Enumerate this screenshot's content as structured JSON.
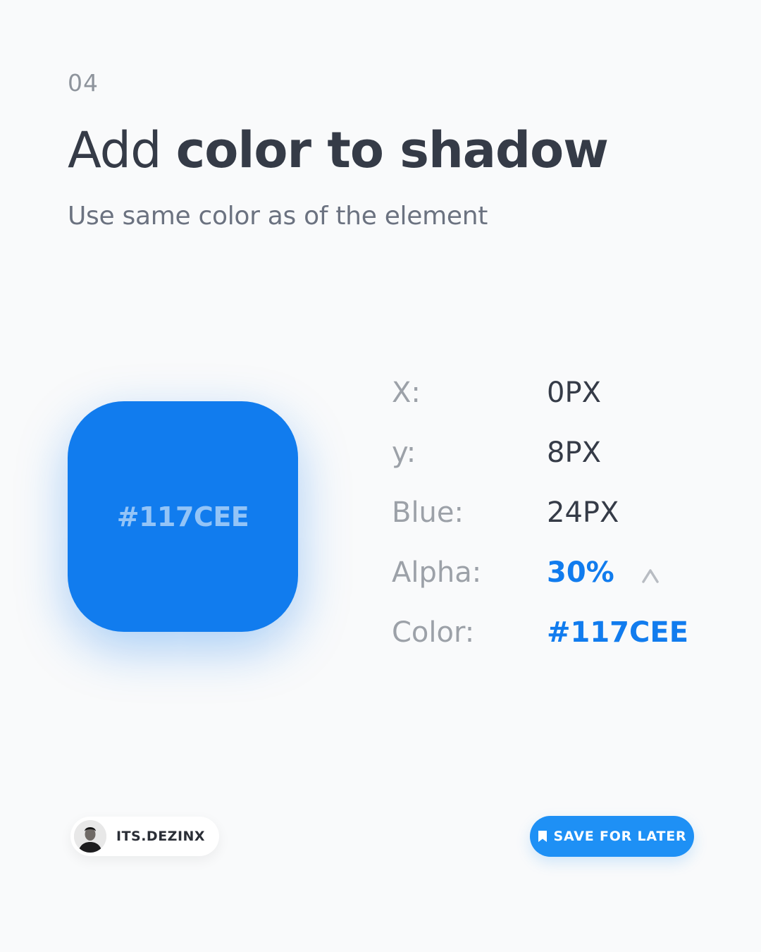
{
  "header": {
    "step": "04",
    "title_light": "Add",
    "title_bold": "color to shadow",
    "subtitle": "Use same color as of the element"
  },
  "swatch": {
    "label": "#117CEE",
    "color": "#117CEE"
  },
  "shadow_props": [
    {
      "key": "X:",
      "value": "0PX"
    },
    {
      "key": "y:",
      "value": "8PX"
    },
    {
      "key": "Blue:",
      "value": "24PX"
    },
    {
      "key": "Alpha:",
      "value": "30%"
    },
    {
      "key": "Color:",
      "value": "#117CEE"
    }
  ],
  "author": {
    "name": "ITS.DEZINX",
    "avatar_icon": "avatar-photo-icon"
  },
  "save": {
    "label": "SAVE FOR LATER",
    "icon": "bookmark-icon"
  },
  "colors": {
    "accent": "#117CEE",
    "button": "#1E90F5",
    "text_dark": "#353B47",
    "text_muted": "#9CA1A8",
    "background": "#F9FAFB"
  }
}
